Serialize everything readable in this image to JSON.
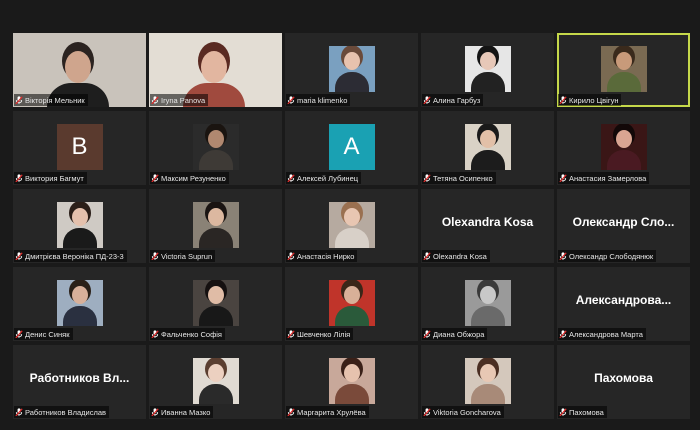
{
  "accent": "#c5d84a",
  "participants": [
    {
      "name": "Вікторія Мельник",
      "kind": "video",
      "bg": "#c9c3bb",
      "skin": "#cfa58d",
      "hair": "#2b2320",
      "shirt": "#1e1e1e"
    },
    {
      "name": "Iryna Panova",
      "kind": "video",
      "bg": "#e3ddd4",
      "skin": "#e2b6a0",
      "hair": "#5a2a22",
      "shirt": "#a04a3e"
    },
    {
      "name": "maria klimenko",
      "kind": "photo",
      "bg": "#7aa0c0",
      "skin": "#e7c2ae",
      "hair": "#6a4a3a",
      "shirt": "#2c2c34"
    },
    {
      "name": "Алина Гарбуз",
      "kind": "photo",
      "bg": "#e6e6e6",
      "skin": "#e7c8b8",
      "hair": "#141414",
      "shirt": "#222"
    },
    {
      "name": "Кирило Цвігун",
      "kind": "photo",
      "bg": "#7a6a52",
      "skin": "#c89a7a",
      "hair": "#3a2a1c",
      "shirt": "#5a6a3a",
      "active": true
    },
    {
      "name": "Виктория Багмут",
      "kind": "letter",
      "letter": "B",
      "color": "#5a3a2e"
    },
    {
      "name": "Максим Резуненко",
      "kind": "photo",
      "bg": "#2b2b2b",
      "skin": "#b08870",
      "hair": "#1a1410",
      "shirt": "#3e3a36"
    },
    {
      "name": "Алексей Лубинец",
      "kind": "letter",
      "letter": "A",
      "color": "#1aa1b3"
    },
    {
      "name": "Тетяна Осипенко",
      "kind": "photo",
      "bg": "#d9d2c6",
      "skin": "#e2c0a8",
      "hair": "#1a1a1a",
      "shirt": "#1c1c1c"
    },
    {
      "name": "Анастасия Замерлова",
      "kind": "photo",
      "bg": "#3a1616",
      "skin": "#d9a592",
      "hair": "#120808",
      "shirt": "#4a1a22"
    },
    {
      "name": "Дмитрієва Вероніка ПД-23-3",
      "kind": "photo",
      "bg": "#cfcac4",
      "skin": "#e4c0ac",
      "hair": "#2a1e18",
      "shirt": "#1a1a1a"
    },
    {
      "name": "Victoria Suprun",
      "kind": "photo",
      "bg": "#8a8276",
      "skin": "#dcb8a0",
      "hair": "#1a1412",
      "shirt": "#2a2624"
    },
    {
      "name": "Анастасія Нирко",
      "kind": "photo",
      "bg": "#b6aaa0",
      "skin": "#e8c6b2",
      "hair": "#9a7050",
      "shirt": "#d8d0c8"
    },
    {
      "name": "Olexandra Kosa",
      "kind": "name",
      "display": "Olexandra Kosa"
    },
    {
      "name": "Олександр Слободянюк",
      "kind": "name",
      "display": "Олександр  Сло..."
    },
    {
      "name": "Денис Синяк",
      "kind": "photo",
      "bg": "#9eaec0",
      "skin": "#d8b09a",
      "hair": "#2a2018",
      "shirt": "#2a3040"
    },
    {
      "name": "Фальченко Софія",
      "kind": "photo",
      "bg": "#4a4440",
      "skin": "#e0bca6",
      "hair": "#151010",
      "shirt": "#181818"
    },
    {
      "name": "Шевченко Лілія",
      "kind": "photo",
      "bg": "#c0342a",
      "skin": "#d8b098",
      "hair": "#3a2618",
      "shirt": "#2a5a3a"
    },
    {
      "name": "Диана Обжора",
      "kind": "photo",
      "bg": "#9a9a9a",
      "skin": "#c8c8c8",
      "hair": "#3a3a3a",
      "shirt": "#6a6a6a"
    },
    {
      "name": "Александрова Марта",
      "kind": "name",
      "display": "Александрова..."
    },
    {
      "name": "Работников Владислав",
      "kind": "name",
      "display": "Работников Вл..."
    },
    {
      "name": "Иванна Мазко",
      "kind": "photo",
      "bg": "#e0dad2",
      "skin": "#ecd0c0",
      "hair": "#5a3e30",
      "shirt": "#2a2a2a"
    },
    {
      "name": "Маргарита Хрулёва",
      "kind": "photo",
      "bg": "#c8a89a",
      "skin": "#e6c2ae",
      "hair": "#3a2018",
      "shirt": "#7a4a3a"
    },
    {
      "name": "Viktoria Goncharova",
      "kind": "photo",
      "bg": "#d4c8bc",
      "skin": "#e8c8b4",
      "hair": "#4a2e22",
      "shirt": "#a88a78"
    },
    {
      "name": "Пахомова",
      "kind": "name",
      "display": "Пахомова"
    }
  ]
}
